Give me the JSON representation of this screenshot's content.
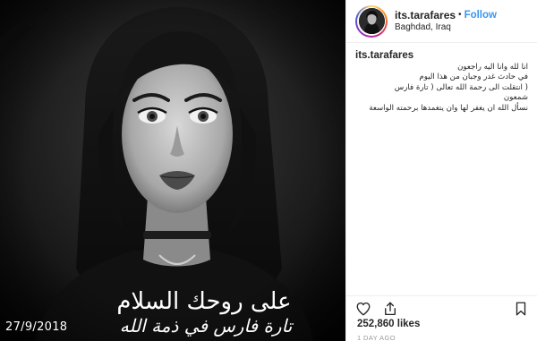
{
  "post": {
    "image": {
      "caption_line1": "على روحك السلام",
      "caption_line2": "تارة فارس في ذمة الله",
      "date": "27/9/2018"
    },
    "header": {
      "username": "its.tarafares",
      "separator": "•",
      "follow_label": "Follow",
      "location": "Baghdad, Iraq"
    },
    "comment": {
      "username": "its.tarafares",
      "lines": [
        "انا لله وانا اليه راجعون",
        "في حادث غدر وجبان من هذا اليوم",
        "( انتقلت الى رحمة الله تعالى ( تارة فارس شمعون",
        "نسأل الله ان يغفر لها وان يتغمدها برحمته الواسعة"
      ]
    },
    "actions": {
      "like_icon": "heart-icon",
      "share_icon": "share-icon",
      "save_icon": "bookmark-icon"
    },
    "likes": "252,860 likes",
    "time_ago": "1 DAY AGO"
  },
  "colors": {
    "link_blue": "#3897f0",
    "text": "#262626",
    "muted": "#999999",
    "border": "#efefef"
  }
}
